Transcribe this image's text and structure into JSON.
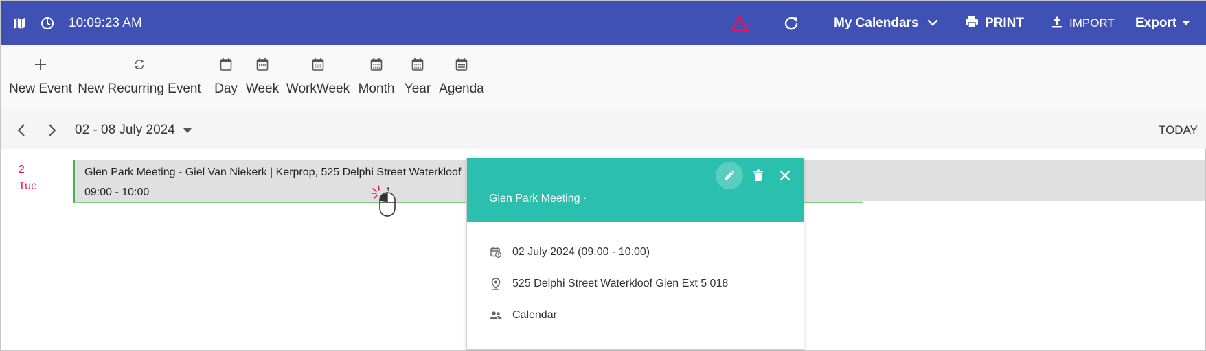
{
  "topbar": {
    "time": "10:09:23 AM",
    "calendars_label": "My Calendars",
    "print_label": "PRINT",
    "import_label": "IMPORT",
    "export_label": "Export",
    "icons": [
      "map-icon",
      "clock-icon",
      "warning-icon",
      "refresh-icon",
      "chevron-down-icon",
      "print-icon",
      "upload-icon",
      "caret-down-icon"
    ],
    "colors": {
      "bar": "#3f51b5",
      "warning": "#e3165b"
    }
  },
  "toolbar": {
    "new_event": "New Event",
    "new_recurring": "New Recurring Event",
    "views": {
      "day": "Day",
      "week": "Week",
      "workweek": "WorkWeek",
      "month": "Month",
      "year": "Year",
      "agenda": "Agenda"
    }
  },
  "datenav": {
    "range": "02 - 08 July 2024",
    "today": "TODAY"
  },
  "agenda": {
    "day_number": "2",
    "day_name": "Tue",
    "event": {
      "title": "Glen Park Meeting - Giel Van Niekerk | Kerprop,   525 Delphi Street Waterkloof",
      "time": "09:00 - 10:00",
      "accent": "#4caf50"
    }
  },
  "popup": {
    "title": "Glen Park Meeting ·",
    "date": "02 July 2024 (09:00 - 10:00)",
    "location": "525 Delphi Street Waterkloof Glen Ext 5 018",
    "calendar": "Calendar",
    "header_color": "#2bbfad"
  }
}
